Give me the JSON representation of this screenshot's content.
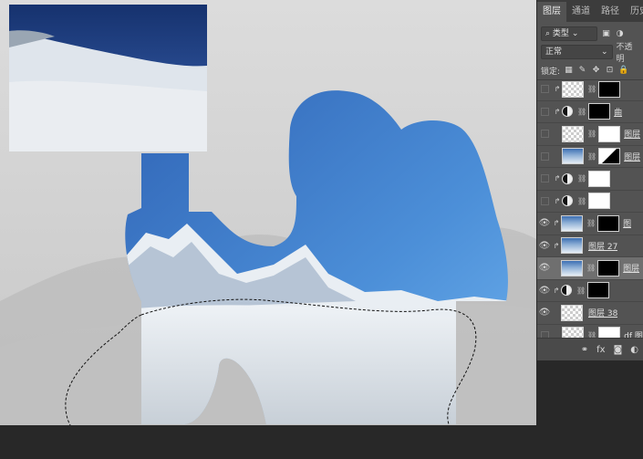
{
  "panel": {
    "tabs": [
      "图层",
      "通道",
      "路径",
      "历史"
    ],
    "kind_filter": "类型",
    "blend_mode": "正常",
    "opacity_label": "不透明",
    "lock_label": "锁定:",
    "layers": [
      {
        "visible": false,
        "clip": true,
        "thumb": "check",
        "mask": "black",
        "name": ""
      },
      {
        "visible": false,
        "clip": true,
        "thumb": "adjust",
        "mask": "black",
        "name": "曲"
      },
      {
        "visible": false,
        "clip": false,
        "thumb": "check",
        "mask": "white",
        "name": "图层"
      },
      {
        "visible": false,
        "clip": false,
        "thumb": "photo",
        "mask": "gradient",
        "name": "图层"
      },
      {
        "visible": false,
        "clip": true,
        "thumb": "adjust",
        "mask": "white",
        "name": ""
      },
      {
        "visible": false,
        "clip": true,
        "thumb": "adjust",
        "mask": "white",
        "name": ""
      },
      {
        "visible": true,
        "clip": true,
        "thumb": "photo",
        "mask": "black",
        "name": "图"
      },
      {
        "visible": true,
        "clip": true,
        "thumb": "photo",
        "mask": "",
        "name": "图层 27"
      },
      {
        "visible": true,
        "clip": false,
        "thumb": "photo",
        "mask": "black",
        "name": "图层",
        "selected": true
      },
      {
        "visible": true,
        "clip": true,
        "thumb": "adjust",
        "mask": "black",
        "name": ""
      },
      {
        "visible": true,
        "clip": false,
        "thumb": "check",
        "mask": "",
        "name": "图层 38"
      },
      {
        "visible": false,
        "clip": false,
        "thumb": "check",
        "mask": "white",
        "name": "df 图"
      }
    ],
    "footer_icons": [
      "link-icon",
      "fx-icon",
      "mask-icon",
      "adjustment-icon"
    ],
    "footer_fx": "fx"
  },
  "colors": {
    "panel_bg": "#535353",
    "selected_layer": "#6f6f6f",
    "canvas_bg": "#d4d4d4"
  }
}
